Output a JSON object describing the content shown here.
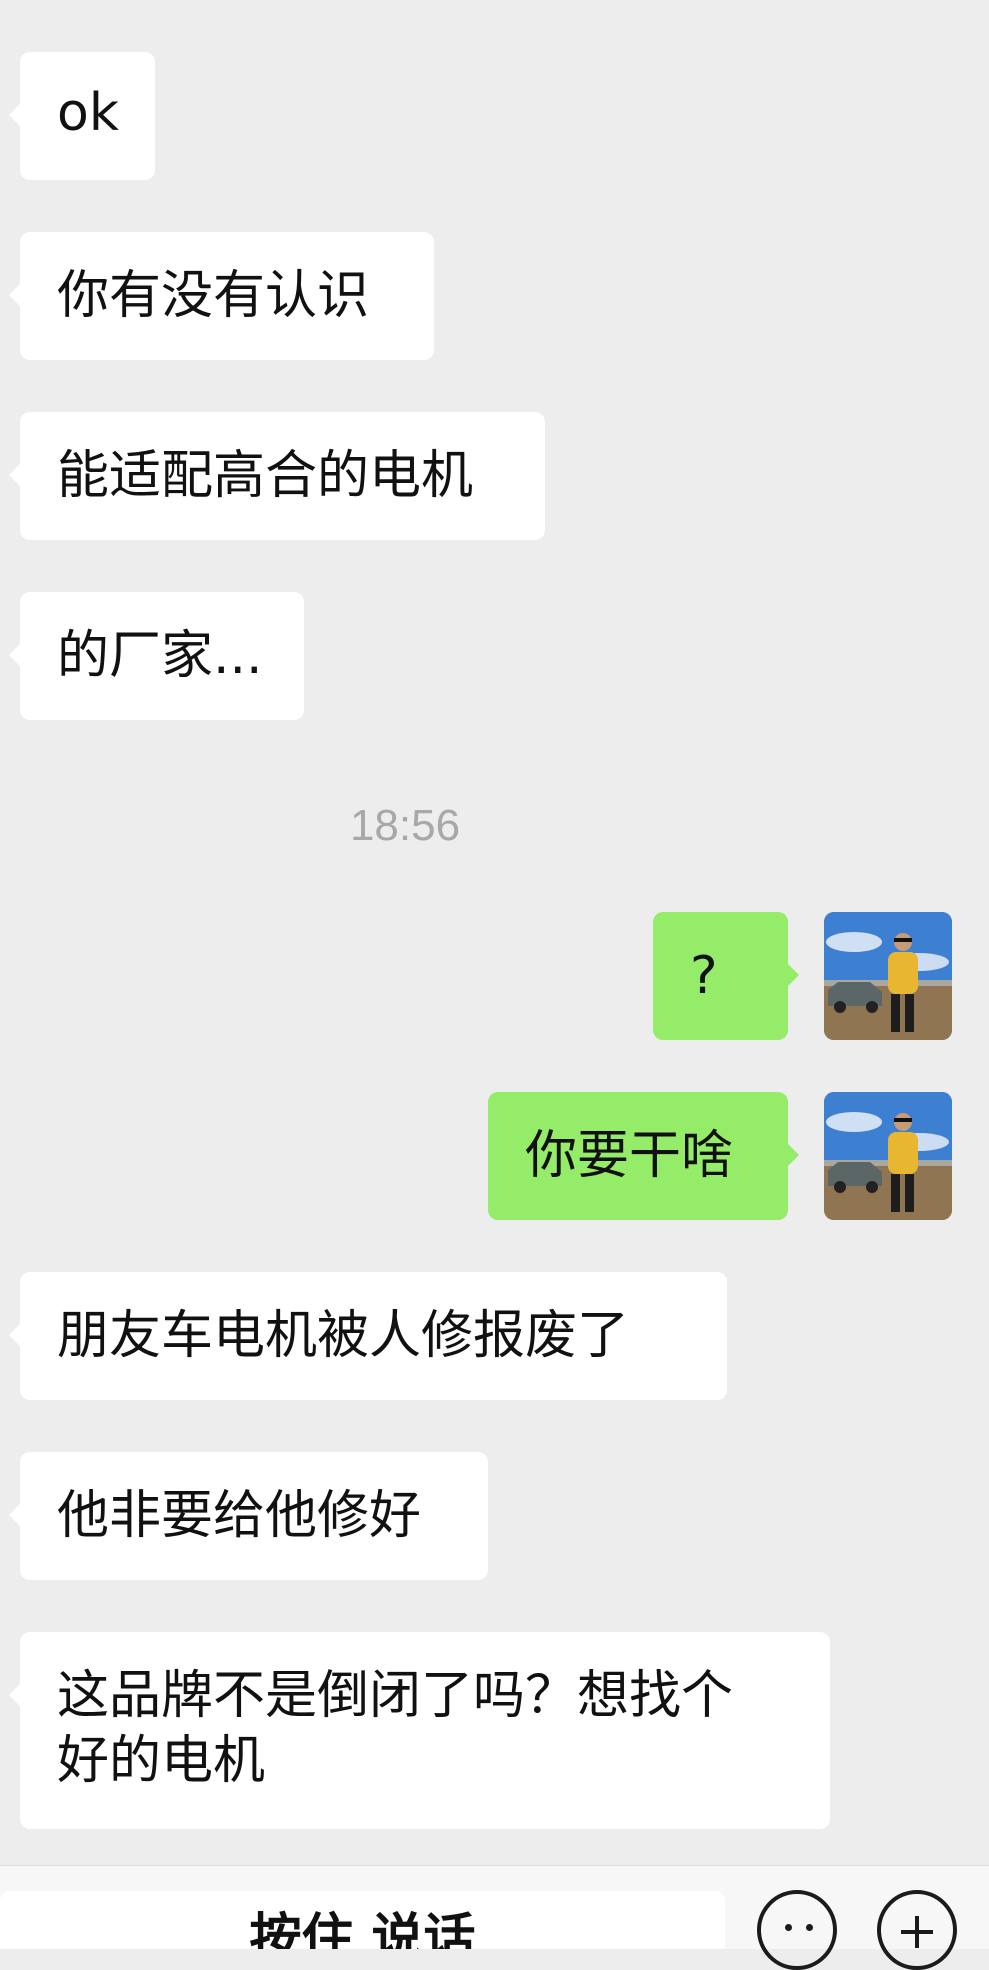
{
  "messages": [
    {
      "side": "left",
      "text": "ok"
    },
    {
      "side": "left",
      "text": "你有没有认识"
    },
    {
      "side": "left",
      "text": "能适配高合的电机"
    },
    {
      "side": "left",
      "text": "的厂家..."
    },
    {
      "timestamp": "18:56"
    },
    {
      "side": "right",
      "text": "?"
    },
    {
      "side": "right",
      "text": "你要干啥"
    },
    {
      "side": "left",
      "text": "朋友车电机被人修报废了"
    },
    {
      "side": "left",
      "text": "他非要给他修好"
    },
    {
      "side": "left",
      "text": "这品牌不是倒闭了吗？想找个\n好的电机"
    }
  ],
  "input_bar": {
    "voice_hold_label": "按住 说话"
  },
  "colors": {
    "background": "#ededed",
    "incoming_bubble": "#ffffff",
    "outgoing_bubble": "#95ec69",
    "timestamp_text": "#a8a8a8"
  },
  "icons": {
    "avatar": "user-avatar-photo",
    "emoji": "emoji-icon",
    "plus": "plus-icon"
  }
}
